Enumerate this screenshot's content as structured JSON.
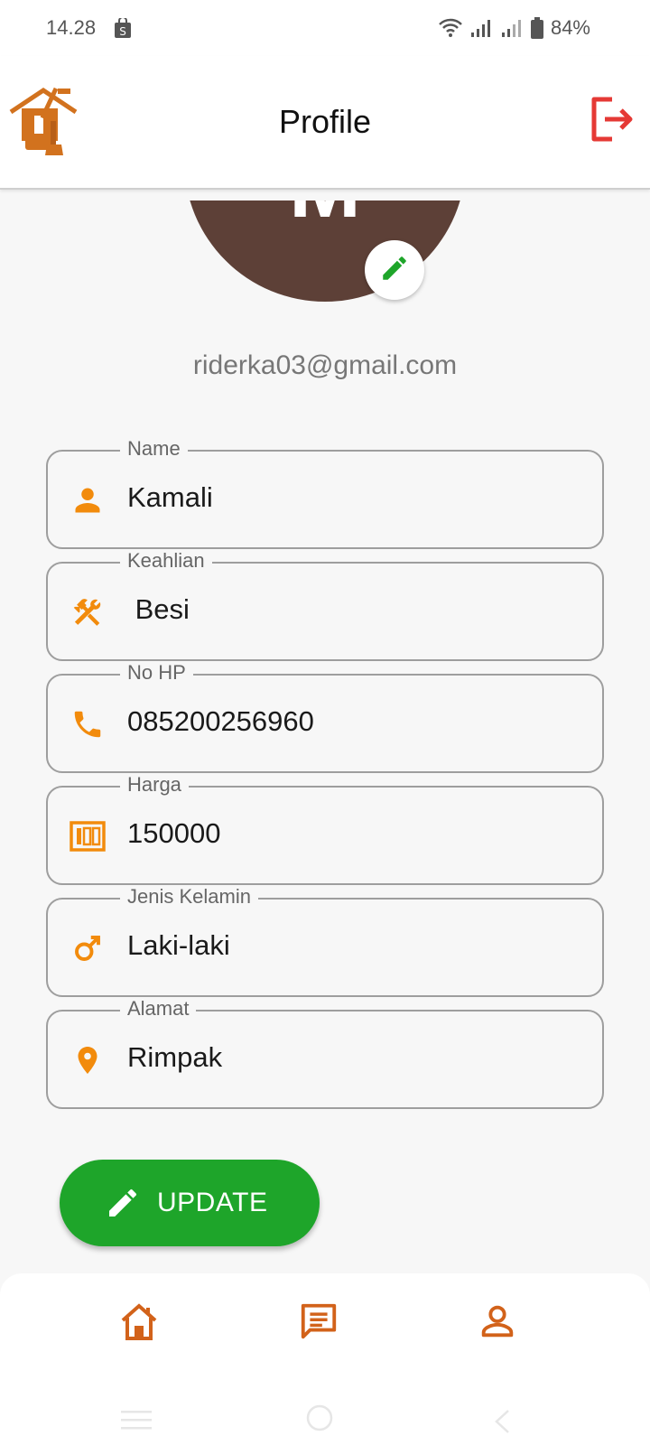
{
  "status_bar": {
    "time": "14.28",
    "battery": "84%"
  },
  "app_bar": {
    "title": "Profile"
  },
  "profile": {
    "avatar_letter": "M",
    "email": "riderka03@gmail.com"
  },
  "fields": {
    "name": {
      "label": "Name",
      "value": "Kamali"
    },
    "keahlian": {
      "label": "Keahlian",
      "value": " Besi"
    },
    "no_hp": {
      "label": "No HP",
      "value": "085200256960"
    },
    "harga": {
      "label": "Harga",
      "value": "150000"
    },
    "jenis_kelamin": {
      "label": "Jenis Kelamin",
      "value": "Laki-laki"
    },
    "alamat": {
      "label": "Alamat",
      "value": "Rimpak"
    }
  },
  "actions": {
    "update_label": "UPDATE"
  },
  "colors": {
    "accent_orange": "#f28b0c",
    "nav_orange": "#d2621a",
    "logout_red": "#e53935",
    "update_green": "#1ea52a",
    "avatar_brown": "#5d4037"
  },
  "icons": {
    "logo": "house-tools-logo",
    "logout": "logout-icon",
    "edit": "pencil-icon",
    "name": "person-icon",
    "keahlian": "tools-icon",
    "no_hp": "phone-icon",
    "harga": "money-icon",
    "jenis_kelamin": "male-icon",
    "alamat": "location-pin-icon",
    "nav": [
      "home-icon",
      "chat-icon",
      "account-icon"
    ]
  }
}
